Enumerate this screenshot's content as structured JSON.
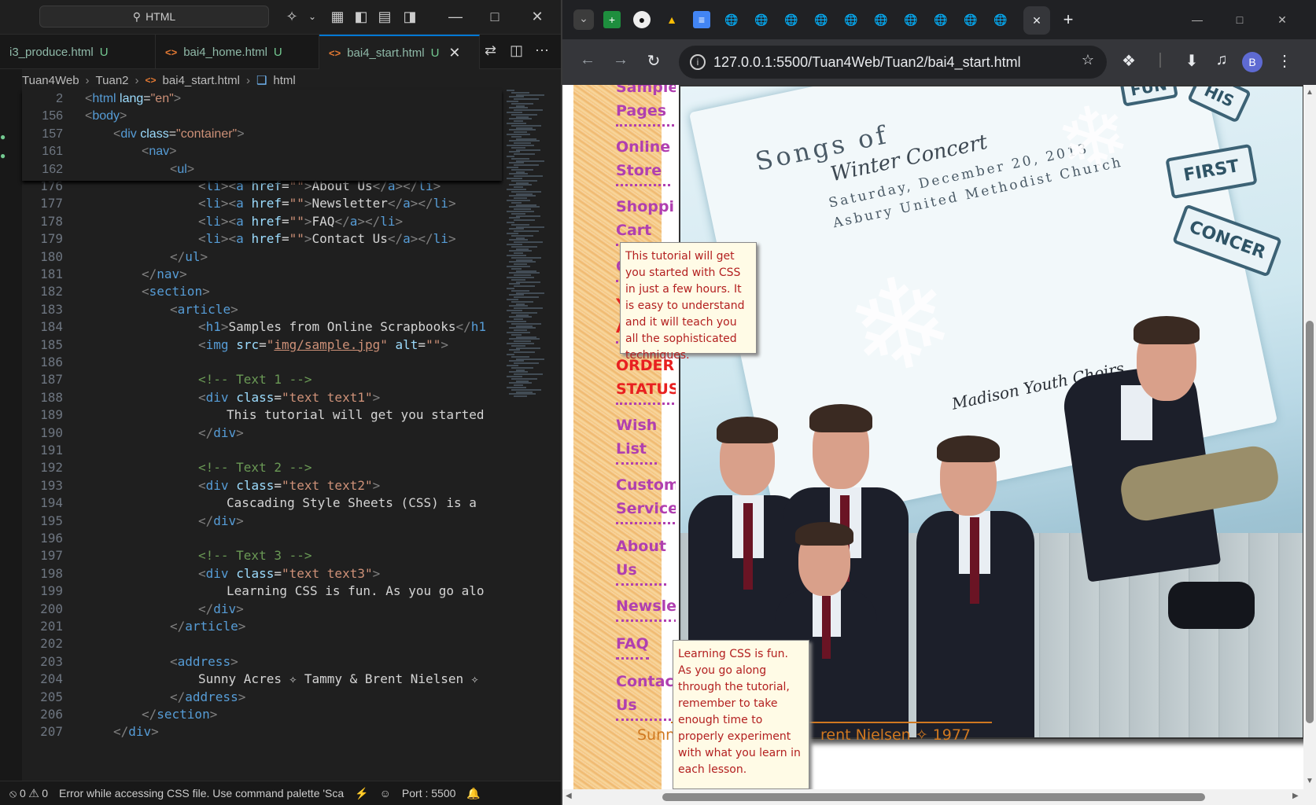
{
  "vscode": {
    "search_text": "HTML",
    "tabs": [
      {
        "label": "i3_produce.html",
        "status": "U"
      },
      {
        "label": "bai4_home.html",
        "status": "U"
      },
      {
        "label": "bai4_start.html",
        "status": "U"
      }
    ],
    "breadcrumb": [
      "Tuan4Web",
      "Tuan2",
      "bai4_start.html",
      "html"
    ],
    "sticky_lines": [
      {
        "n": "2",
        "indent": 0,
        "html": "<span class=tg>&lt;</span><span class=tn>html</span> <span class=at>lang</span><span class=tx>=</span><span class=av>\"en\"</span><span class=tg>&gt;</span>"
      },
      {
        "n": "156",
        "indent": 0,
        "html": "<span class=tg>&lt;</span><span class=tn>body</span><span class=tg>&gt;</span>"
      },
      {
        "n": "157",
        "indent": 1,
        "html": "<span class=tg>&lt;</span><span class=tn>div</span> <span class=at>class</span><span class=tx>=</span><span class=av>\"container\"</span><span class=tg>&gt;</span>"
      },
      {
        "n": "161",
        "indent": 2,
        "html": "<span class=tg>&lt;</span><span class=tn>nav</span><span class=tg>&gt;</span>"
      },
      {
        "n": "162",
        "indent": 3,
        "html": "<span class=tg>&lt;</span><span class=tn>ul</span><span class=tg>&gt;</span>"
      }
    ],
    "lines": [
      {
        "n": "176",
        "indent": 4,
        "html": "<span class=tg>&lt;</span><span class=tn>li</span><span class=tg>&gt;&lt;</span><span class=tn>a</span> <span class=at>href</span><span class=tx>=</span><span class=av>\"\"</span><span class=tg>&gt;</span><span class=tx>About Us</span><span class=tg>&lt;/</span><span class=tn>a</span><span class=tg>&gt;&lt;/</span><span class=tn>li</span><span class=tg>&gt;</span>"
      },
      {
        "n": "177",
        "indent": 4,
        "html": "<span class=tg>&lt;</span><span class=tn>li</span><span class=tg>&gt;&lt;</span><span class=tn>a</span> <span class=at>href</span><span class=tx>=</span><span class=av>\"\"</span><span class=tg>&gt;</span><span class=tx>Newsletter</span><span class=tg>&lt;/</span><span class=tn>a</span><span class=tg>&gt;&lt;/</span><span class=tn>li</span><span class=tg>&gt;</span>"
      },
      {
        "n": "178",
        "indent": 4,
        "html": "<span class=tg>&lt;</span><span class=tn>li</span><span class=tg>&gt;&lt;</span><span class=tn>a</span> <span class=at>href</span><span class=tx>=</span><span class=av>\"\"</span><span class=tg>&gt;</span><span class=tx>FAQ</span><span class=tg>&lt;/</span><span class=tn>a</span><span class=tg>&gt;&lt;/</span><span class=tn>li</span><span class=tg>&gt;</span>"
      },
      {
        "n": "179",
        "indent": 4,
        "html": "<span class=tg>&lt;</span><span class=tn>li</span><span class=tg>&gt;&lt;</span><span class=tn>a</span> <span class=at>href</span><span class=tx>=</span><span class=av>\"\"</span><span class=tg>&gt;</span><span class=tx>Contact Us</span><span class=tg>&lt;/</span><span class=tn>a</span><span class=tg>&gt;&lt;/</span><span class=tn>li</span><span class=tg>&gt;</span>"
      },
      {
        "n": "180",
        "indent": 3,
        "html": "<span class=tg>&lt;/</span><span class=tn>ul</span><span class=tg>&gt;</span>"
      },
      {
        "n": "181",
        "indent": 2,
        "html": "<span class=tg>&lt;/</span><span class=tn>nav</span><span class=tg>&gt;</span>"
      },
      {
        "n": "182",
        "indent": 2,
        "html": "<span class=tg>&lt;</span><span class=tn>section</span><span class=tg>&gt;</span>"
      },
      {
        "n": "183",
        "indent": 3,
        "html": "<span class=tg>&lt;</span><span class=tn>article</span><span class=tg>&gt;</span>"
      },
      {
        "n": "184",
        "indent": 4,
        "html": "<span class=tg>&lt;</span><span class=tn>h1</span><span class=tg>&gt;</span><span class=tx>Samples from Online Scrapbooks</span><span class=tg>&lt;/</span><span class=tn>h1</span>"
      },
      {
        "n": "185",
        "indent": 4,
        "html": "<span class=tg>&lt;</span><span class=tn>img</span> <span class=at>src</span><span class=tx>=</span><span class=av>\"<u>img/sample.jpg</u>\"</span> <span class=at>alt</span><span class=tx>=</span><span class=av>\"\"</span><span class=tg>&gt;</span>"
      },
      {
        "n": "186",
        "indent": 0,
        "html": ""
      },
      {
        "n": "187",
        "indent": 4,
        "html": "<span class=cm>&lt;!-- Text 1 --&gt;</span>"
      },
      {
        "n": "188",
        "indent": 4,
        "html": "<span class=tg>&lt;</span><span class=tn>div</span> <span class=at>class</span><span class=tx>=</span><span class=av>\"text text1\"</span><span class=tg>&gt;</span>"
      },
      {
        "n": "189",
        "indent": 5,
        "html": "<span class=tx>This tutorial will get you started</span>"
      },
      {
        "n": "190",
        "indent": 4,
        "html": "<span class=tg>&lt;/</span><span class=tn>div</span><span class=tg>&gt;</span>"
      },
      {
        "n": "191",
        "indent": 0,
        "html": ""
      },
      {
        "n": "192",
        "indent": 4,
        "html": "<span class=cm>&lt;!-- Text 2 --&gt;</span>"
      },
      {
        "n": "193",
        "indent": 4,
        "html": "<span class=tg>&lt;</span><span class=tn>div</span> <span class=at>class</span><span class=tx>=</span><span class=av>\"text text2\"</span><span class=tg>&gt;</span>"
      },
      {
        "n": "194",
        "indent": 5,
        "html": "<span class=tx>Cascading Style Sheets (CSS) is a</span>"
      },
      {
        "n": "195",
        "indent": 4,
        "html": "<span class=tg>&lt;/</span><span class=tn>div</span><span class=tg>&gt;</span>"
      },
      {
        "n": "196",
        "indent": 0,
        "html": ""
      },
      {
        "n": "197",
        "indent": 4,
        "html": "<span class=cm>&lt;!-- Text 3 --&gt;</span>"
      },
      {
        "n": "198",
        "indent": 4,
        "html": "<span class=tg>&lt;</span><span class=tn>div</span> <span class=at>class</span><span class=tx>=</span><span class=av>\"text text3\"</span><span class=tg>&gt;</span>"
      },
      {
        "n": "199",
        "indent": 5,
        "html": "<span class=tx>Learning CSS is fun. As you go alo</span>"
      },
      {
        "n": "200",
        "indent": 4,
        "html": "<span class=tg>&lt;/</span><span class=tn>div</span><span class=tg>&gt;</span>"
      },
      {
        "n": "201",
        "indent": 3,
        "html": "<span class=tg>&lt;/</span><span class=tn>article</span><span class=tg>&gt;</span>"
      },
      {
        "n": "202",
        "indent": 0,
        "html": ""
      },
      {
        "n": "203",
        "indent": 3,
        "html": "<span class=tg>&lt;</span><span class=tn>address</span><span class=tg>&gt;</span>"
      },
      {
        "n": "204",
        "indent": 4,
        "html": "<span class=tx>Sunny Acres ✧ Tammy &amp; Brent Nielsen ✧</span>"
      },
      {
        "n": "205",
        "indent": 3,
        "html": "<span class=tg>&lt;/</span><span class=tn>address</span><span class=tg>&gt;</span>"
      },
      {
        "n": "206",
        "indent": 2,
        "html": "<span class=tg>&lt;/</span><span class=tn>section</span><span class=tg>&gt;</span>"
      },
      {
        "n": "207",
        "indent": 1,
        "html": "<span class=tg>&lt;/</span><span class=tn>div</span><span class=tg>&gt;</span>"
      }
    ],
    "status": {
      "errors": "0",
      "warnings": "0",
      "message": "Error while accessing CSS file. Use command palette 'Sca",
      "port": "Port : 5500"
    }
  },
  "chrome": {
    "url": "127.0.0.1:5500/Tuan4Web/Tuan2/bai4_start.html",
    "profile_initial": "B"
  },
  "page": {
    "nav": [
      {
        "label": "Sample\nPages",
        "red": false
      },
      {
        "label": "Online\nStore",
        "red": false
      },
      {
        "label": "Shoppi\nCart",
        "red": false
      },
      {
        "label": "Check",
        "red": false
      },
      {
        "label": "YOUR\nACCOU",
        "red": true
      },
      {
        "label": "ORDER\nSTATUS",
        "red": true
      },
      {
        "label": "Wish\nList",
        "red": false
      },
      {
        "label": "Custom\nService",
        "red": false
      },
      {
        "label": "About\nUs",
        "red": false
      },
      {
        "label": "Newsle",
        "red": false
      },
      {
        "label": "FAQ",
        "red": false
      },
      {
        "label": "Contact\nUs",
        "red": false
      }
    ],
    "photo_text": {
      "songs": "Songs of",
      "winter": "Winter Concert",
      "date": "Saturday, December 20, 2013",
      "church": "Asbury United Methodist Church",
      "choirs": "Madison Youth Choirs",
      "tags": [
        "FUN",
        "HIS",
        "FIRST",
        "CONCER"
      ]
    },
    "tip1": "This tutorial will get you started with CSS in just a few hours. It is easy to understand and it will teach you all the sophisticated techniques.",
    "tip3": "Learning CSS is fun. As you go along through the tutorial, remember to take enough time to properly experiment with what you learn in each lesson.",
    "address_left": "Sunny",
    "address_right": "rent Nielsen ✧ 1977"
  }
}
